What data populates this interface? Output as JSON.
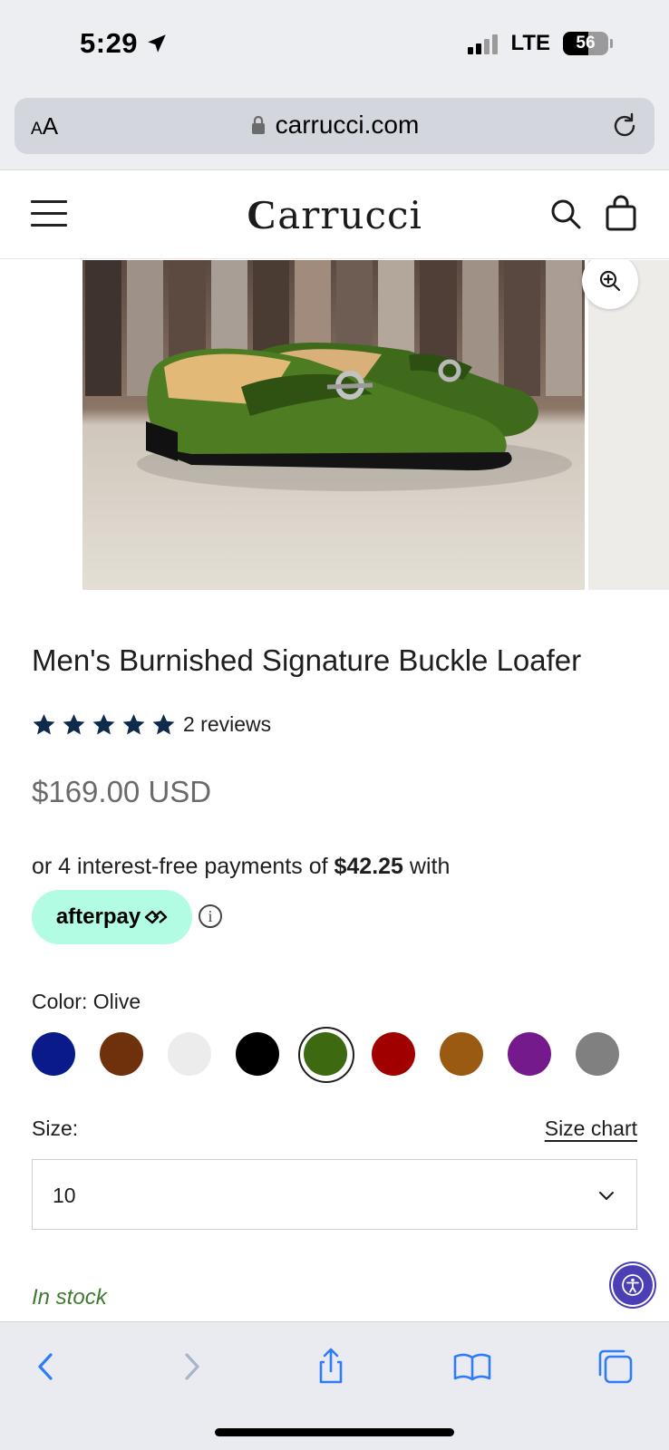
{
  "status_bar": {
    "time": "5:29",
    "network": "LTE",
    "battery": "56",
    "battery_level": 0.56
  },
  "browser": {
    "text_size_small": "A",
    "text_size_large": "A",
    "url": "carrucci.com"
  },
  "site": {
    "logo_initial": "C",
    "logo_rest": "arrucci"
  },
  "product": {
    "title": "Men's Burnished Signature Buckle Loafer",
    "rating_stars": 5,
    "review_count": "2 reviews",
    "price": "$169.00 USD",
    "installment_prefix": "or 4 interest-free payments of",
    "installment_amount": "$42.25",
    "installment_suffix": "with",
    "afterpay_label": "afterpay",
    "info_symbol": "i",
    "color_label": "Color: Olive",
    "colors": [
      {
        "name": "navy",
        "hex": "#0a1a8a"
      },
      {
        "name": "brown",
        "hex": "#6e310c"
      },
      {
        "name": "white",
        "hex": "#ececec"
      },
      {
        "name": "black",
        "hex": "#000000"
      },
      {
        "name": "olive",
        "hex": "#3d6a10"
      },
      {
        "name": "red",
        "hex": "#a00000"
      },
      {
        "name": "cognac",
        "hex": "#9a5a12"
      },
      {
        "name": "purple",
        "hex": "#741a8c"
      },
      {
        "name": "gray",
        "hex": "#808080"
      }
    ],
    "selected_color_index": 4,
    "size_label": "Size:",
    "size_chart_link": "Size chart",
    "size_value": "10",
    "stock_status": "In stock"
  },
  "colors": {
    "star": "#0f2b4b",
    "stock_green": "#3e7b2e",
    "afterpay_mint": "#b2fce4",
    "ios_blue": "#2f7cf6",
    "a11y_purple": "#4b3fb5"
  },
  "icons": {
    "location": "location-arrow-icon",
    "lock": "lock-icon",
    "reload": "reload-icon",
    "menu": "hamburger-menu-icon",
    "search": "search-icon",
    "bag": "shopping-bag-icon",
    "zoom": "zoom-in-icon",
    "accessibility": "accessibility-icon",
    "back": "back-chevron-icon",
    "forward": "forward-chevron-icon",
    "share": "share-icon",
    "bookmarks": "book-icon",
    "tabs": "tabs-icon"
  }
}
